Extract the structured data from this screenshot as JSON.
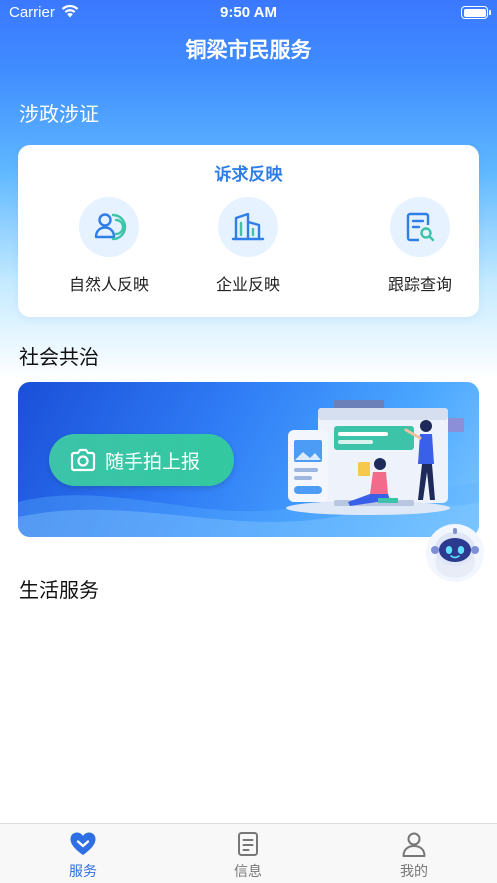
{
  "status_bar": {
    "carrier": "Carrier",
    "time": "9:50 AM",
    "icons": [
      "wifi-icon",
      "battery-icon"
    ]
  },
  "header": {
    "title": "铜梁市民服务"
  },
  "sections": {
    "gov": {
      "title": "涉政涉证"
    },
    "social": {
      "title": "社会共治"
    },
    "life": {
      "title": "生活服务"
    }
  },
  "appeal_card": {
    "title": "诉求反映",
    "items": [
      {
        "label": "自然人反映",
        "icon": "person-icon"
      },
      {
        "label": "企业反映",
        "icon": "building-icon"
      },
      {
        "label": "跟踪查询",
        "icon": "document-search-icon"
      }
    ]
  },
  "banner": {
    "button_label": "随手拍上报",
    "icon": "camera-icon"
  },
  "assistant": {
    "icon": "robot-assistant-icon"
  },
  "tabbar": {
    "tabs": [
      {
        "label": "服务",
        "icon": "heart-icon",
        "active": true
      },
      {
        "label": "信息",
        "icon": "document-icon",
        "active": false
      },
      {
        "label": "我的",
        "icon": "user-icon",
        "active": false
      }
    ]
  },
  "colors": {
    "primary": "#3b78ff",
    "accent": "#2f7fe8",
    "button_green": "#3cc3a8",
    "active_tab": "#2f6fe4",
    "inactive_tab": "#777777"
  }
}
